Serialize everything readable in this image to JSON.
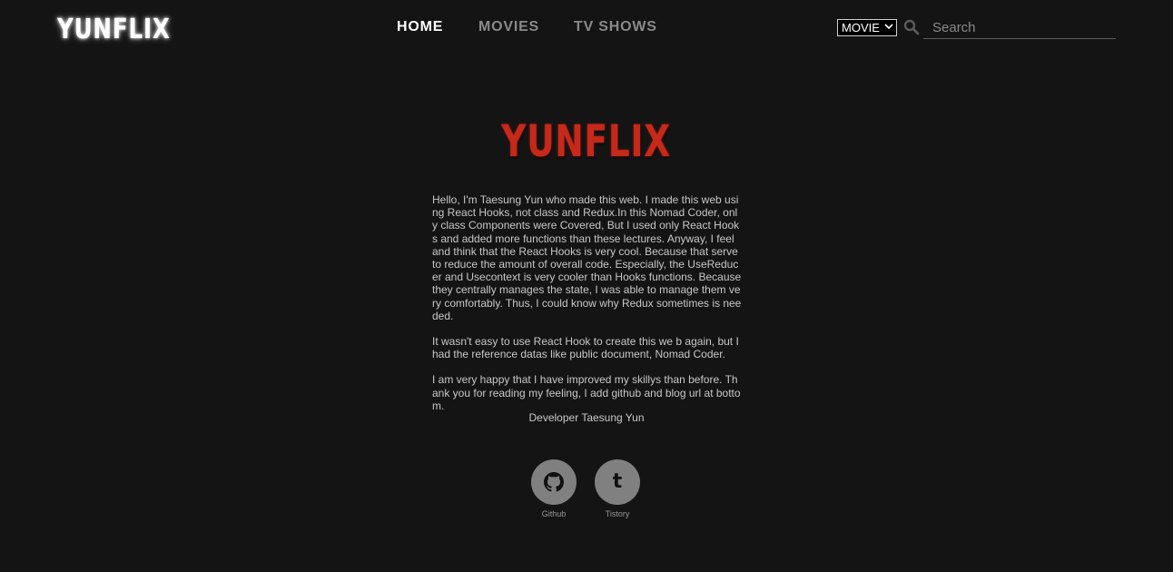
{
  "header": {
    "brand": "YUNFLIX",
    "nav": [
      {
        "label": "HOME",
        "active": true
      },
      {
        "label": "MOVIES",
        "active": false
      },
      {
        "label": "TV SHOWS",
        "active": false
      }
    ],
    "type_select": {
      "selected": "MOVIE"
    },
    "search": {
      "placeholder": "Search",
      "value": ""
    }
  },
  "main": {
    "logo_text": "YUNFLIX",
    "paragraphs": [
      "Hello, I'm Taesung Yun who made this web. I made this web using React Hooks, not class and Redux.In this Nomad Coder, only class Components were Covered, But I used only React Hooks and added more functions than these lectures. Anyway, I feel and think that the React Hooks is very cool. Because that serve to reduce the amount of overall code. Especially, the UseReducer and Usecontext is very cooler than Hooks functions. Because they centrally manages the state, I was able to manage them very comfortably. Thus, I could know why Redux sometimes is needed.",
      "It wasn't easy to use React Hook to create this we b again, but I had the reference datas like public document, Nomad Coder.",
      "I am very happy that I have improved my skillys than before. Thank you for reading my feeling, I add github and blog url at bottom."
    ],
    "signature": "Developer Taesung Yun",
    "links": [
      {
        "label": "Github",
        "icon": "github-icon"
      },
      {
        "label": "Tistory",
        "icon": "tistory-icon"
      }
    ]
  },
  "colors": {
    "background": "#141414",
    "brand_red": "#c6291a",
    "nav_active": "#ffffff",
    "nav_inactive": "#8a8a8a",
    "link_circle": "#808080"
  }
}
